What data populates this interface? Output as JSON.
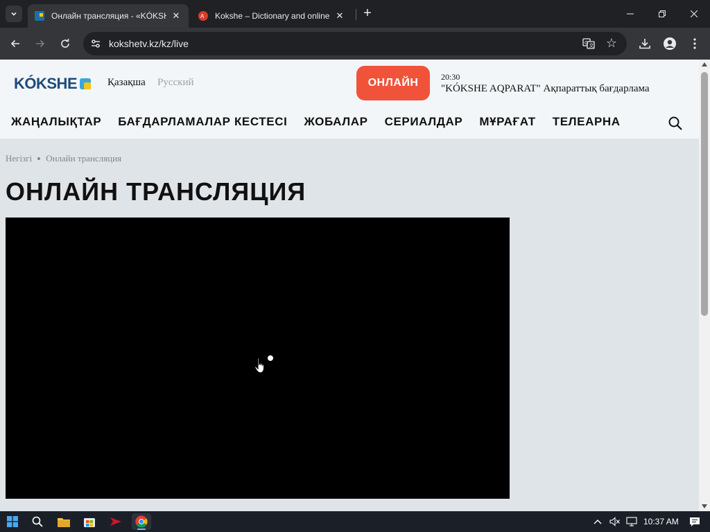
{
  "browser": {
    "tabs": [
      {
        "title": "Онлайн трансляция - «KÓKSHE",
        "active": true
      },
      {
        "title": "Kokshe – Dictionary and online",
        "active": false
      }
    ],
    "url": "kokshetv.kz/kz/live"
  },
  "site": {
    "logo_text": "KÓKSHE",
    "languages": {
      "kz": "Қазақша",
      "ru": "Русский"
    },
    "online_button": "ОНЛАЙН",
    "now_playing": {
      "time": "20:30",
      "title": "\"KÓKSHE AQPARAT\" Ақпараттық бағдарлама"
    },
    "nav": [
      "ЖАҢАЛЫҚТАР",
      "БАҒДАРЛАМАЛАР КЕСТЕСІ",
      "ЖОБАЛАР",
      "СЕРИАЛДАР",
      "МҰРАҒАТ",
      "ТЕЛЕАРНА"
    ]
  },
  "breadcrumb": [
    "Негізгі",
    "Онлайн трансляция"
  ],
  "page_title": "ОНЛАЙН ТРАНСЛЯЦИЯ",
  "taskbar": {
    "time": "10:37 AM"
  },
  "colors": {
    "accent": "#f0533a",
    "logo": "#1f4b7a",
    "logo_mark_blue": "#3aa6dd",
    "logo_mark_yellow": "#f5c518"
  }
}
